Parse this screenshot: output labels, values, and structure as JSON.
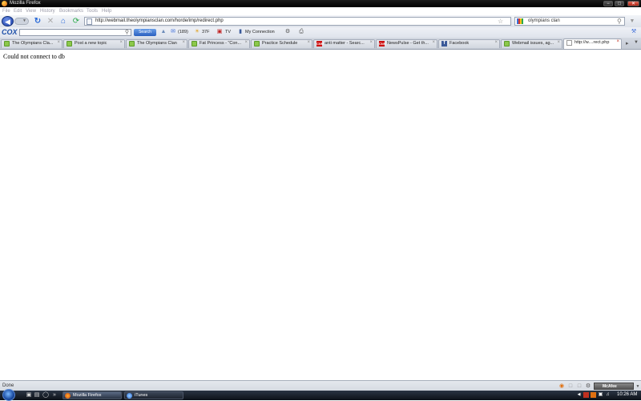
{
  "window": {
    "title": "Mozilla Firefox",
    "controls": {
      "minimize": "−",
      "maximize": "□",
      "close": "✕"
    }
  },
  "menu": [
    "File",
    "Edit",
    "View",
    "History",
    "Bookmarks",
    "Tools",
    "Help"
  ],
  "nav": {
    "url": "http://webmail.theolympiansclan.com/horde/imp/redirect.php",
    "search_value": "olympians clan"
  },
  "cox_toolbar": {
    "logo": "COX",
    "search_button": "Search",
    "mail_count": "(189)",
    "weather": "37F",
    "tv": "TV",
    "connection": "My Connection"
  },
  "tabs": [
    {
      "label": "The Olympians Cla...",
      "icon": "speech-bubble-icon"
    },
    {
      "label": "Post a new topic",
      "icon": "speech-bubble-icon"
    },
    {
      "label": "The Olympians Clan",
      "icon": "speech-bubble-icon"
    },
    {
      "label": "Fat Princess - \"Con...",
      "icon": "speech-bubble-icon"
    },
    {
      "label": "Practice Schedule",
      "icon": "speech-bubble-icon"
    },
    {
      "label": "anti matter - Searc...",
      "icon": "cnn-icon"
    },
    {
      "label": "NewsPulse - Get th...",
      "icon": "cnn-icon"
    },
    {
      "label": "Facebook",
      "icon": "facebook-icon"
    },
    {
      "label": "Webmail issues, ag...",
      "icon": "speech-bubble-icon"
    },
    {
      "label": "http://w....rect.php",
      "icon": "page-icon"
    }
  ],
  "content": {
    "message": "Could not connect to db"
  },
  "status": {
    "text": "Done",
    "mcafee": "McAfee"
  },
  "taskbar": {
    "buttons": [
      {
        "label": "Mozilla Firefox"
      },
      {
        "label": "iTunes"
      }
    ],
    "clock": "10:26 AM"
  },
  "colors": {
    "accent": "#1c4fa8",
    "titlebar": "#000000",
    "taskbar": "#1a2230"
  }
}
